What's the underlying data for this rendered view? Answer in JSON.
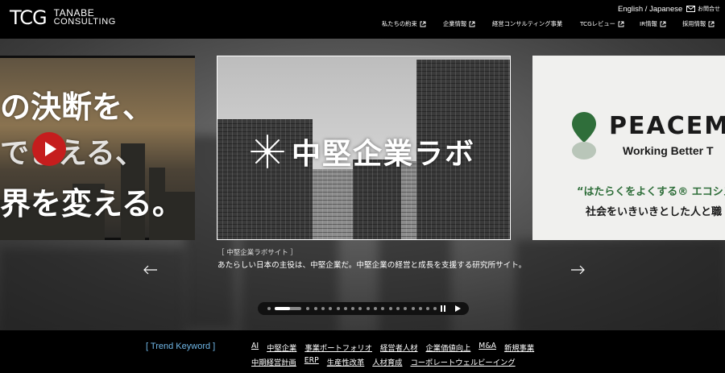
{
  "header": {
    "logo_mark": "TCG",
    "logo_line1": "TANABE",
    "logo_line2": "CONSULTING",
    "language": "English / Japanese",
    "contact": "お問合せ",
    "nav": [
      {
        "label": "私たちの約束",
        "external": true
      },
      {
        "label": "企業情報",
        "external": true
      },
      {
        "label": "経営コンサルティング事業",
        "external": false
      },
      {
        "label": "TCGレビュー",
        "external": true
      },
      {
        "label": "IR情報",
        "external": true
      },
      {
        "label": "採用情報",
        "external": true
      }
    ]
  },
  "hero": {
    "left_slide": {
      "line1": "の決断を、",
      "line2": "できえる、",
      "line3": "界を変える。"
    },
    "center_slide": {
      "title": "中堅企業ラボ",
      "tag": "［ 中堅企業ラボサイト ］",
      "caption": "あたらしい日本の主役は、中堅企業だ。中堅企業の経営と成長を支援する研究所サイト。"
    },
    "right_slide": {
      "brand": "PEACEM",
      "tagline": "Working Better T",
      "eco_line": "“はたらくをよくする® エコシス",
      "society_line": "社会をいきいきとした人と職"
    },
    "pagination": {
      "total": 20,
      "current": 2
    }
  },
  "trend": {
    "label": "[ Trend Keyword ]",
    "row1": [
      "AI",
      "中堅企業",
      "事業ポートフォリオ",
      "経営者人材",
      "企業価値向上",
      "M&A",
      "新規事業"
    ],
    "row2": [
      "中期経営計画",
      "ERP",
      "生産性改革",
      "人材育成",
      "コーポレートウェルビーイング"
    ]
  }
}
